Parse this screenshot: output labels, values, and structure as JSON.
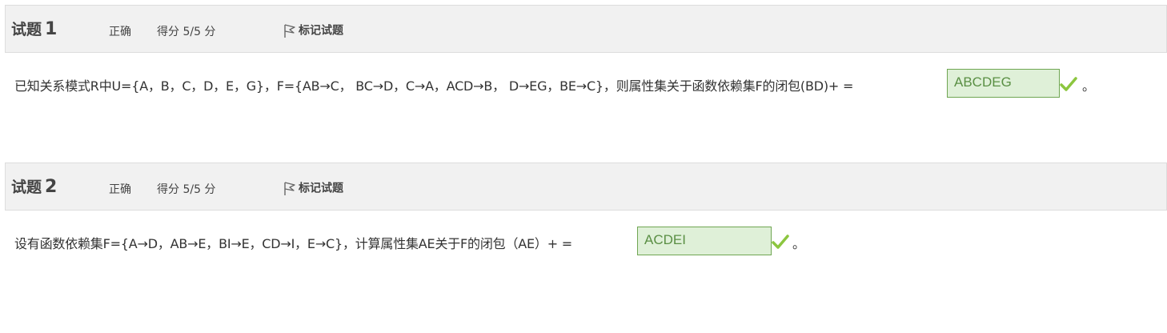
{
  "questions": [
    {
      "title_label": "试题",
      "number": "1",
      "state": "正确",
      "grade": "得分 5/5 分",
      "flag_label": "标记试题",
      "flag_icon": "flag-icon",
      "text": "已知关系模式R中U={A，B，C，D，E，G}，F={AB→C， BC→D，C→A，ACD→B， D→EG，BE→C}，则属性集关于函数依赖集F的闭包(BD)+ = ",
      "answer": "ABCDEG",
      "check_icon": "check-icon",
      "end_mark": "。"
    },
    {
      "title_label": "试题",
      "number": "2",
      "state": "正确",
      "grade": "得分 5/5 分",
      "flag_label": "标记试题",
      "flag_icon": "flag-icon",
      "text": "设有函数依赖集F={A→D，AB→E，BI→E，CD→I，E→C}，计算属性集AE关于F的闭包（AE）+ =",
      "answer": "ACDEI",
      "check_icon": "check-icon",
      "end_mark": "。"
    }
  ],
  "colors": {
    "header_bg": "#f1f1f1",
    "answer_bg": "#dff0d8",
    "answer_border": "#6fa652",
    "answer_text": "#5a8f44",
    "check": "#8cc63f"
  }
}
